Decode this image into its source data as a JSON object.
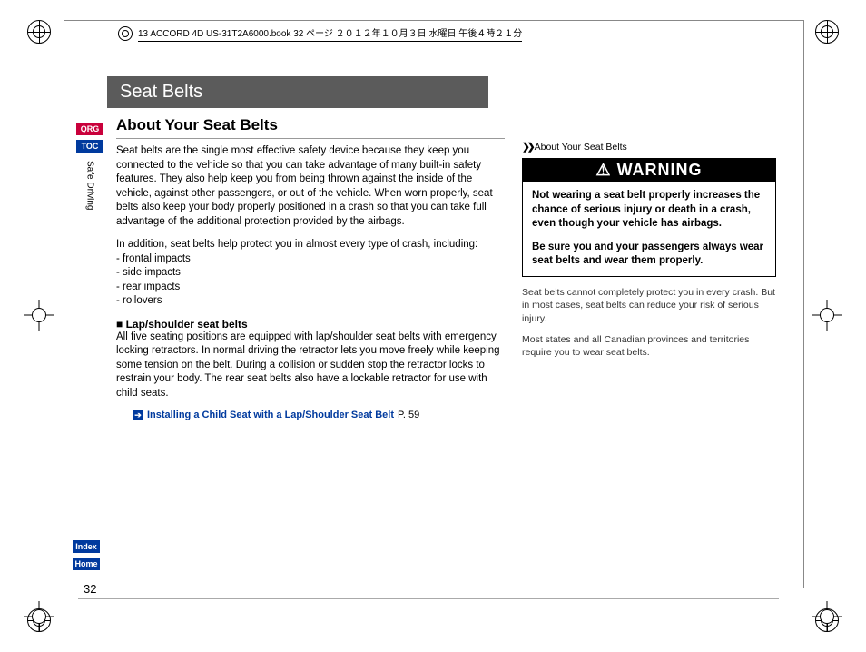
{
  "book_meta": "13 ACCORD 4D US-31T2A6000.book  32 ページ  ２０１２年１０月３日  水曜日  午後４時２１分",
  "section_title": "Seat Belts",
  "nav": {
    "qrg": "QRG",
    "toc": "TOC",
    "vertical": "Safe Driving",
    "index": "Index",
    "home": "Home"
  },
  "page_number": "32",
  "subtitle": "About Your Seat Belts",
  "intro_para": "Seat belts are the single most effective safety device because they keep you connected to the vehicle so that you can take advantage of many built-in safety features. They also help keep you from being thrown against the inside of the vehicle, against other passengers, or out of the vehicle. When worn properly, seat belts also keep your body properly positioned in a crash so that you can take full advantage of the additional protection provided by the airbags.",
  "list_intro": "In addition, seat belts help protect you in almost every type of crash, including:",
  "bullets": [
    "- frontal impacts",
    "- side impacts",
    "- rear impacts",
    "- rollovers"
  ],
  "sub_heading": "Lap/shoulder seat belts",
  "sub_para": "All five seating positions are equipped with lap/shoulder seat belts with emergency locking retractors. In normal driving the retractor lets you move freely while keeping some tension on the belt. During a collision or sudden stop the retractor locks to restrain your body. The rear seat belts also have a lockable retractor for use with child seats.",
  "xref": {
    "label": "Installing a Child Seat with a Lap/Shoulder Seat Belt",
    "page": "P. 59"
  },
  "side": {
    "topic": "About Your Seat Belts",
    "warn_title": "WARNING",
    "warn_p1": "Not wearing a seat belt properly increases the chance of serious injury or death in a crash, even though your vehicle has airbags.",
    "warn_p2": "Be sure you and your passengers always wear seat belts and wear them properly.",
    "note1": "Seat belts cannot completely protect you in every crash. But in most cases, seat belts can reduce your risk of serious injury.",
    "note2": "Most states and all Canadian provinces and territories require you to wear seat belts."
  }
}
